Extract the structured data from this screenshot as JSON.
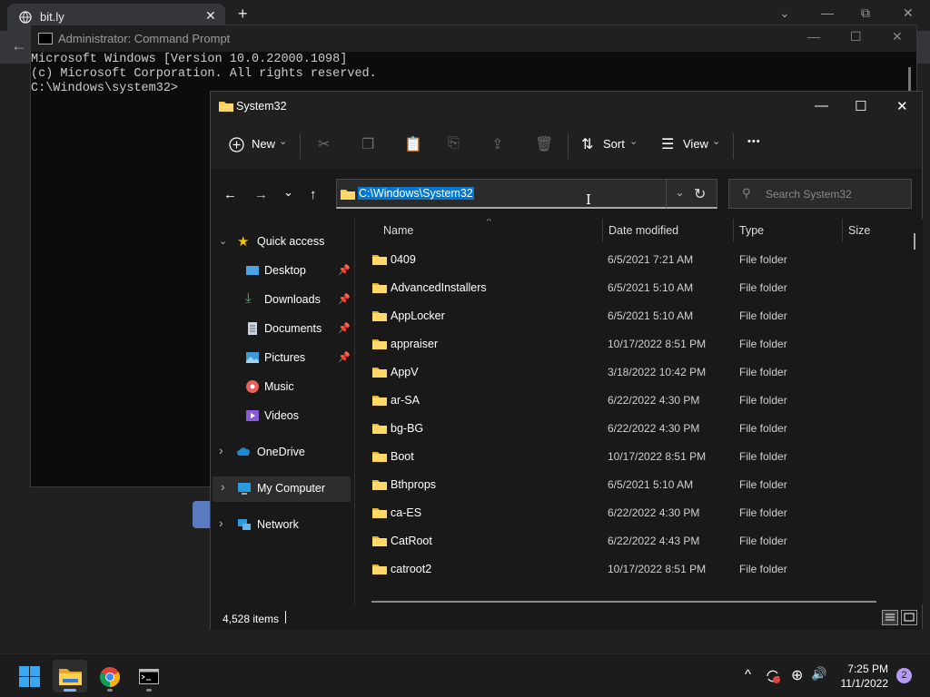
{
  "browser": {
    "tab_title": "bit.ly",
    "tab_close": "✕",
    "new_tab": "+",
    "controls": {
      "down": "⌄",
      "minimize": "—",
      "restore": "⧉",
      "close": "✕"
    },
    "back": "←"
  },
  "cmd": {
    "title": "Administrator: Command Prompt",
    "lines": [
      "Microsoft Windows [Version 10.0.22000.1098]",
      "(c) Microsoft Corporation. All rights reserved.",
      "C:\\Windows\\system32>"
    ],
    "controls": {
      "minimize": "—",
      "maximize": "☐",
      "close": "✕"
    }
  },
  "explorer": {
    "title": "System32",
    "controls": {
      "minimize": "—",
      "maximize": "☐",
      "close": "✕"
    },
    "toolbar": {
      "new_label": "New",
      "sort_label": "Sort",
      "view_label": "View",
      "more_label": "•••",
      "dropdown": "⌄"
    },
    "nav": {
      "back": "←",
      "forward": "→",
      "recent": "⌄",
      "up": "↑",
      "refresh": "↻"
    },
    "address": {
      "path": "C:\\Windows\\System32",
      "dropdown": "⌄"
    },
    "search": {
      "placeholder": "Search System32",
      "icon": "⚲"
    },
    "sidebar": {
      "quick_access": "Quick access",
      "items": [
        {
          "label": "Desktop",
          "pinned": true
        },
        {
          "label": "Downloads",
          "pinned": true
        },
        {
          "label": "Documents",
          "pinned": true
        },
        {
          "label": "Pictures",
          "pinned": true
        },
        {
          "label": "Music",
          "pinned": false
        },
        {
          "label": "Videos",
          "pinned": false
        }
      ],
      "onedrive": "OneDrive",
      "mycomputer": "My Computer",
      "network": "Network",
      "chev_down": "⌄",
      "chev_right": "›",
      "pin": "📌"
    },
    "columns": {
      "name": "Name",
      "date": "Date modified",
      "type": "Type",
      "size": "Size",
      "sort_arrow": "^"
    },
    "rows": [
      {
        "name": "0409",
        "date": "6/5/2021 7:21 AM",
        "type": "File folder"
      },
      {
        "name": "AdvancedInstallers",
        "date": "6/5/2021 5:10 AM",
        "type": "File folder"
      },
      {
        "name": "AppLocker",
        "date": "6/5/2021 5:10 AM",
        "type": "File folder"
      },
      {
        "name": "appraiser",
        "date": "10/17/2022 8:51 PM",
        "type": "File folder"
      },
      {
        "name": "AppV",
        "date": "3/18/2022 10:42 PM",
        "type": "File folder"
      },
      {
        "name": "ar-SA",
        "date": "6/22/2022 4:30 PM",
        "type": "File folder"
      },
      {
        "name": "bg-BG",
        "date": "6/22/2022 4:30 PM",
        "type": "File folder"
      },
      {
        "name": "Boot",
        "date": "10/17/2022 8:51 PM",
        "type": "File folder"
      },
      {
        "name": "Bthprops",
        "date": "6/5/2021 5:10 AM",
        "type": "File folder"
      },
      {
        "name": "ca-ES",
        "date": "6/22/2022 4:30 PM",
        "type": "File folder"
      },
      {
        "name": "CatRoot",
        "date": "6/22/2022 4:43 PM",
        "type": "File folder"
      },
      {
        "name": "catroot2",
        "date": "10/17/2022 8:51 PM",
        "type": "File folder"
      }
    ],
    "status": {
      "count": "4,528 items"
    }
  },
  "taskbar": {
    "time": "7:25 PM",
    "date": "11/1/2022",
    "notifications": "2",
    "tray": {
      "chevron": "^",
      "globe": "⊕",
      "volume": "🔊"
    }
  },
  "colors": {
    "accent": "#0078d4",
    "folder": "#f8c846"
  }
}
